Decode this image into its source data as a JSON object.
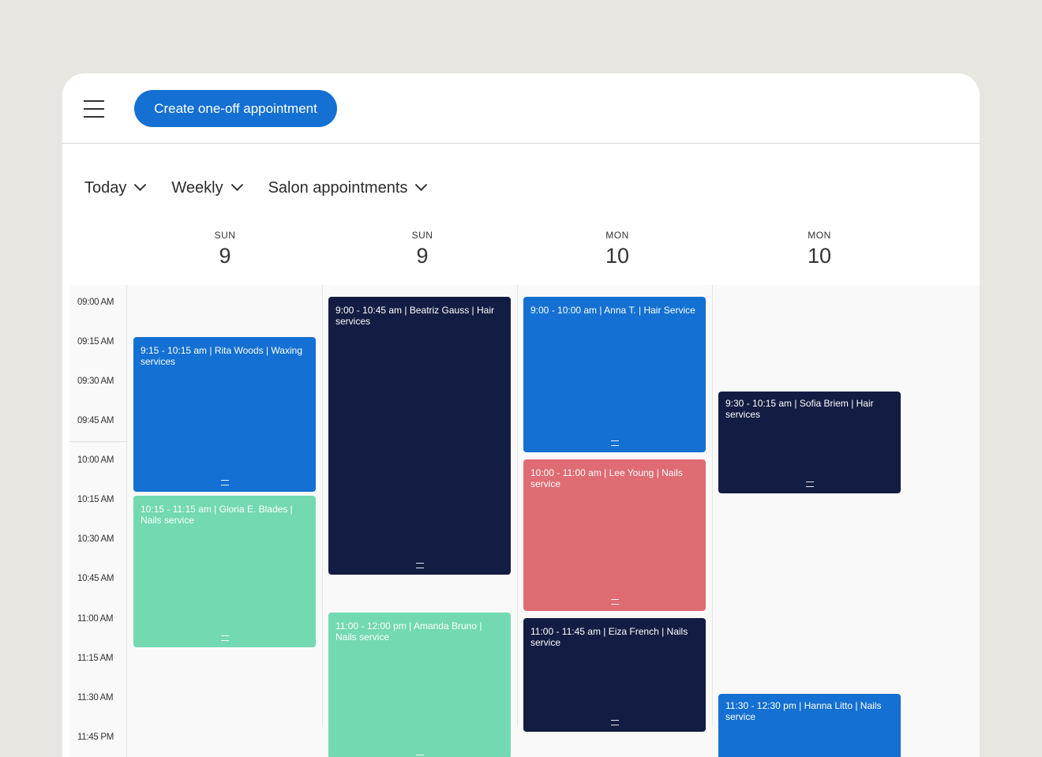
{
  "toolbar": {
    "menu_icon": "hamburger-menu-icon",
    "create_label": "Create one-off appointment"
  },
  "filters": [
    {
      "label": "Today",
      "icon": "chevron-down-icon"
    },
    {
      "label": "Weekly",
      "icon": "chevron-down-icon"
    },
    {
      "label": "Salon appointments",
      "icon": "chevron-down-icon"
    }
  ],
  "days": [
    {
      "dow": "SUN",
      "num": "9"
    },
    {
      "dow": "SUN",
      "num": "9"
    },
    {
      "dow": "MON",
      "num": "10"
    },
    {
      "dow": "MON",
      "num": "10"
    }
  ],
  "times": [
    "09:00 AM",
    "09:15 AM",
    "09:30 AM",
    "09:45 AM",
    "10:00 AM",
    "10:15 AM",
    "10:30 AM",
    "10:45 AM",
    "11:00 AM",
    "11:15 AM",
    "11:30 AM",
    "11:45 PM"
  ],
  "appointments": [
    {
      "text": "9:15 - 10:15 am | Rita Woods | Waxing services",
      "color": "#1470d2"
    },
    {
      "text": "10:15 - 11:15 am | Gloria E. Blades | Nails service",
      "color": "#72d9b0"
    },
    {
      "text": "9:00 - 10:45 am | Beatriz Gauss | Hair services",
      "color": "#131c42"
    },
    {
      "text": "11:00 - 12:00 pm | Amanda Bruno | Nails service",
      "color": "#72d9b0"
    },
    {
      "text": "9:00 - 10:00 am | Anna T. | Hair Service",
      "color": "#1470d2"
    },
    {
      "text": "10:00 - 11:00 am | Lee Young | Nails service",
      "color": "#df6b73"
    },
    {
      "text": "11:00 - 11:45 am | Eiza French | Nails service",
      "color": "#131c42"
    },
    {
      "text": "9:30 - 10:15 am | Sofia Briem | Hair services",
      "color": "#131c42"
    },
    {
      "text": "11:30 - 12:30 pm | Hanna Litto | Nails service",
      "color": "#1470d2"
    }
  ]
}
